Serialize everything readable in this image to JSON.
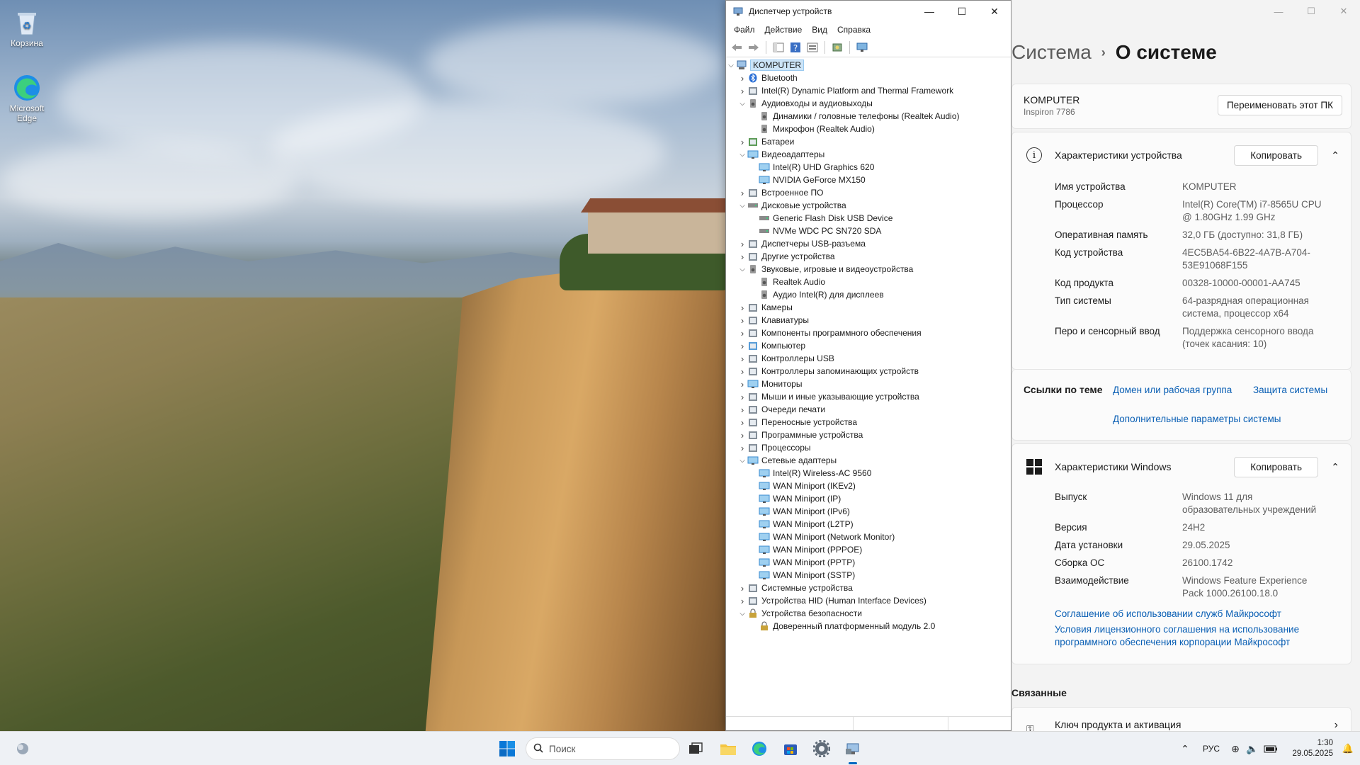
{
  "desktop": {
    "icons": [
      {
        "label": "Корзина",
        "icon": "recycle-bin-icon"
      },
      {
        "label": "Microsoft Edge",
        "icon": "edge-icon"
      }
    ]
  },
  "device_manager": {
    "title": "Диспетчер устройств",
    "menu": [
      "Файл",
      "Действие",
      "Вид",
      "Справка"
    ],
    "root": "KOMPUTER",
    "tree": [
      {
        "label": "Bluetooth",
        "level": 1,
        "state": "collapsed",
        "icon": "bluetooth-icon"
      },
      {
        "label": "Intel(R) Dynamic Platform and Thermal Framework",
        "level": 1,
        "state": "collapsed",
        "icon": "device-folder-icon"
      },
      {
        "label": "Аудиовходы и аудиовыходы",
        "level": 1,
        "state": "expanded",
        "icon": "speaker-icon"
      },
      {
        "label": "Динамики / головные телефоны (Realtek Audio)",
        "level": 2,
        "icon": "speaker-icon"
      },
      {
        "label": "Микрофон (Realtek Audio)",
        "level": 2,
        "icon": "microphone-icon"
      },
      {
        "label": "Батареи",
        "level": 1,
        "state": "collapsed",
        "icon": "battery-icon"
      },
      {
        "label": "Видеоадаптеры",
        "level": 1,
        "state": "expanded",
        "icon": "display-adapter-icon"
      },
      {
        "label": "Intel(R) UHD Graphics 620",
        "level": 2,
        "icon": "display-adapter-icon"
      },
      {
        "label": "NVIDIA GeForce MX150",
        "level": 2,
        "icon": "display-adapter-icon"
      },
      {
        "label": "Встроенное ПО",
        "level": 1,
        "state": "collapsed",
        "icon": "firmware-icon"
      },
      {
        "label": "Дисковые устройства",
        "level": 1,
        "state": "expanded",
        "icon": "disk-icon"
      },
      {
        "label": "Generic Flash Disk USB Device",
        "level": 2,
        "icon": "disk-icon"
      },
      {
        "label": "NVMe WDC PC SN720 SDA",
        "level": 2,
        "icon": "disk-icon"
      },
      {
        "label": "Диспетчеры USB-разъема",
        "level": 1,
        "state": "collapsed",
        "icon": "usb-icon"
      },
      {
        "label": "Другие устройства",
        "level": 1,
        "state": "collapsed",
        "icon": "unknown-device-icon"
      },
      {
        "label": "Звуковые, игровые и видеоустройства",
        "level": 1,
        "state": "expanded",
        "icon": "speaker-icon"
      },
      {
        "label": "Realtek Audio",
        "level": 2,
        "icon": "speaker-icon"
      },
      {
        "label": "Аудио Intel(R) для дисплеев",
        "level": 2,
        "icon": "speaker-icon"
      },
      {
        "label": "Камеры",
        "level": 1,
        "state": "collapsed",
        "icon": "camera-icon"
      },
      {
        "label": "Клавиатуры",
        "level": 1,
        "state": "collapsed",
        "icon": "keyboard-icon"
      },
      {
        "label": "Компоненты программного обеспечения",
        "level": 1,
        "state": "collapsed",
        "icon": "software-component-icon"
      },
      {
        "label": "Компьютер",
        "level": 1,
        "state": "collapsed",
        "icon": "computer-icon"
      },
      {
        "label": "Контроллеры USB",
        "level": 1,
        "state": "collapsed",
        "icon": "usb-icon"
      },
      {
        "label": "Контроллеры запоминающих устройств",
        "level": 1,
        "state": "collapsed",
        "icon": "storage-controller-icon"
      },
      {
        "label": "Мониторы",
        "level": 1,
        "state": "collapsed",
        "icon": "monitor-icon"
      },
      {
        "label": "Мыши и иные указывающие устройства",
        "level": 1,
        "state": "collapsed",
        "icon": "mouse-icon"
      },
      {
        "label": "Очереди печати",
        "level": 1,
        "state": "collapsed",
        "icon": "printer-icon"
      },
      {
        "label": "Переносные устройства",
        "level": 1,
        "state": "collapsed",
        "icon": "portable-device-icon"
      },
      {
        "label": "Программные устройства",
        "level": 1,
        "state": "collapsed",
        "icon": "software-device-icon"
      },
      {
        "label": "Процессоры",
        "level": 1,
        "state": "collapsed",
        "icon": "processor-icon"
      },
      {
        "label": "Сетевые адаптеры",
        "level": 1,
        "state": "expanded",
        "icon": "network-adapter-icon"
      },
      {
        "label": "Intel(R) Wireless-AC 9560",
        "level": 2,
        "icon": "network-adapter-icon"
      },
      {
        "label": "WAN Miniport (IKEv2)",
        "level": 2,
        "icon": "network-adapter-icon"
      },
      {
        "label": "WAN Miniport (IP)",
        "level": 2,
        "icon": "network-adapter-icon"
      },
      {
        "label": "WAN Miniport (IPv6)",
        "level": 2,
        "icon": "network-adapter-icon"
      },
      {
        "label": "WAN Miniport (L2TP)",
        "level": 2,
        "icon": "network-adapter-icon"
      },
      {
        "label": "WAN Miniport (Network Monitor)",
        "level": 2,
        "icon": "network-adapter-icon"
      },
      {
        "label": "WAN Miniport (PPPOE)",
        "level": 2,
        "icon": "network-adapter-icon"
      },
      {
        "label": "WAN Miniport (PPTP)",
        "level": 2,
        "icon": "network-adapter-icon"
      },
      {
        "label": "WAN Miniport (SSTP)",
        "level": 2,
        "icon": "network-adapter-icon"
      },
      {
        "label": "Системные устройства",
        "level": 1,
        "state": "collapsed",
        "icon": "system-device-icon"
      },
      {
        "label": "Устройства HID (Human Interface Devices)",
        "level": 1,
        "state": "collapsed",
        "icon": "hid-icon"
      },
      {
        "label": "Устройства безопасности",
        "level": 1,
        "state": "expanded",
        "icon": "security-device-icon"
      },
      {
        "label": "Доверенный платформенный модуль 2.0",
        "level": 2,
        "icon": "security-device-icon"
      }
    ]
  },
  "settings": {
    "breadcrumb_parent": "Система",
    "breadcrumb_current": "О системе",
    "pc_name": "KOMPUTER",
    "pc_model": "Inspiron 7786",
    "rename_button": "Переименовать этот ПК",
    "device_specs": {
      "title": "Характеристики устройства",
      "copy_button": "Копировать",
      "rows": [
        {
          "k": "Имя устройства",
          "v": "KOMPUTER"
        },
        {
          "k": "Процессор",
          "v": "Intel(R) Core(TM) i7-8565U CPU @ 1.80GHz   1.99 GHz"
        },
        {
          "k": "Оперативная память",
          "v": "32,0 ГБ (доступно: 31,8 ГБ)"
        },
        {
          "k": "Код устройства",
          "v": "4EC5BA54-6B22-4A7B-A704-53E91068F155"
        },
        {
          "k": "Код продукта",
          "v": "00328-10000-00001-AA745"
        },
        {
          "k": "Тип системы",
          "v": "64-разрядная операционная система, процессор x64"
        },
        {
          "k": "Перо и сенсорный ввод",
          "v": "Поддержка сенсорного ввода (точек касания: 10)"
        }
      ]
    },
    "related_links": {
      "label": "Ссылки по теме",
      "links": [
        "Домен или рабочая группа",
        "Защита системы",
        "Дополнительные параметры системы"
      ]
    },
    "windows_specs": {
      "title": "Характеристики Windows",
      "copy_button": "Копировать",
      "rows": [
        {
          "k": "Выпуск",
          "v": "Windows 11 для образовательных учреждений"
        },
        {
          "k": "Версия",
          "v": "24H2"
        },
        {
          "k": "Дата установки",
          "v": "29.05.2025"
        },
        {
          "k": "Сборка ОС",
          "v": "26100.1742"
        },
        {
          "k": "Взаимодействие",
          "v": "Windows Feature Experience Pack 1000.26100.18.0"
        }
      ],
      "links": [
        "Соглашение об использовании служб Майкрософт",
        "Условия лицензионного соглашения на использование программного обеспечения корпорации Майкрософт"
      ]
    },
    "related_heading": "Связанные",
    "product_key_item": "Ключ продукта и активация"
  },
  "taskbar": {
    "search_placeholder": "Поиск",
    "lang": "РУС",
    "time": "1:30",
    "date": "29.05.2025"
  },
  "colors": {
    "accent": "#0067c0",
    "link": "#0a5fb4",
    "selection": "#cce4f7"
  }
}
